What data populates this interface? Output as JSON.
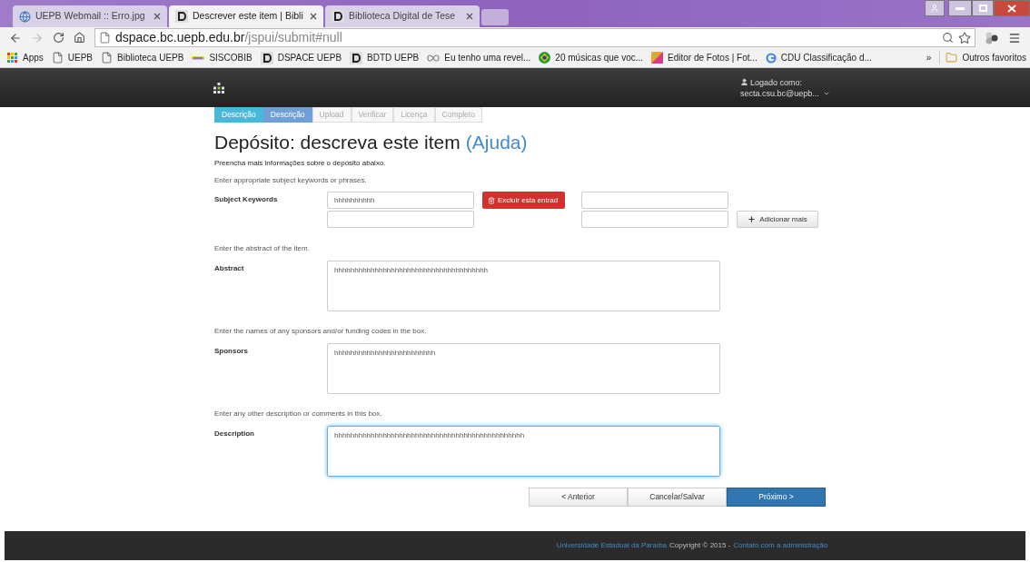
{
  "browser": {
    "tabs": [
      {
        "title": "UEPB Webmail :: Erro.jpg",
        "kind": "mail",
        "selected": false
      },
      {
        "title": "Descrever este item | Bibli",
        "kind": "dspace",
        "selected": true
      },
      {
        "title": "Biblioteca Digital de Tese",
        "kind": "dspace",
        "selected": false
      }
    ],
    "address": {
      "host": "dspace.bc.uepb.edu.br",
      "path": "/jspui/submit#null"
    },
    "bookmarks": [
      {
        "label": "Apps",
        "kind": "apps"
      },
      {
        "label": "UEPB",
        "kind": "page"
      },
      {
        "label": "Biblioteca UEPB",
        "kind": "page"
      },
      {
        "label": "SISCOBIB",
        "kind": "uepb"
      },
      {
        "label": "DSPACE UEPB",
        "kind": "dspace"
      },
      {
        "label": "BDTD UEPB",
        "kind": "dspace"
      },
      {
        "label": "Eu tenho uma revel...",
        "kind": "loop"
      },
      {
        "label": "20 músicas que voc...",
        "kind": "flag"
      },
      {
        "label": "Editor de Fotos | Fot...",
        "kind": "photo"
      },
      {
        "label": "CDU Classificação d...",
        "kind": "google"
      }
    ],
    "overflow": "»",
    "other_bookmarks": "Outros favoritos"
  },
  "header": {
    "logged_label": "Logado como:",
    "user": "secta.csu.bc@uepb..."
  },
  "steps": [
    {
      "label": "Descrição",
      "completed": true,
      "selected": false
    },
    {
      "label": "Descrição",
      "completed": false,
      "selected": true
    },
    {
      "label": "Upload",
      "completed": false,
      "selected": false
    },
    {
      "label": "Verificar",
      "completed": false,
      "selected": false
    },
    {
      "label": "Licença",
      "completed": false,
      "selected": false
    },
    {
      "label": "Completo",
      "completed": false,
      "selected": false
    }
  ],
  "title": "Depósito: descreva este item",
  "help_link": "(Ajuda)",
  "intro": "Preencha mais informações sobre o depósito abaixo.",
  "keywords": {
    "hint": "Enter appropriate subject keywords or phrases.",
    "label": "Subject Keywords",
    "column_1": [
      {
        "value": "hhhhhhhhhh",
        "focused": false
      },
      {
        "focused": false
      }
    ],
    "column_2": [
      {
        "focused": false
      },
      {
        "focused": false
      }
    ],
    "delete_button": "Excluir esta entrad",
    "add_button": "Adicionar mais"
  },
  "text_fields": [
    {
      "hint": "Enter the abstract of the item.",
      "label": "Abstract",
      "value": "hhhhhhhhhhhhhhhhhhhhhhhhhhhhhhhhhhhhhh",
      "focused": false
    },
    {
      "hint": "Enter the names of any sponsors and/or funding codes in the box.",
      "label": "Sponsors",
      "value": "hhhhhhhhhhhhhhhhhhhhhhhhh",
      "focused": false
    },
    {
      "hint": "Enter any other description or comments in this box.",
      "label": "Description",
      "value": "hhhhhhhhhhhhhhhhhhhhhhhhhhhhhhhhhhhhhhhhhhhhhhh",
      "focused": true
    }
  ],
  "buttons": [
    {
      "label": "< Anterior",
      "kind": "default"
    },
    {
      "label": "Cancelar/Salvar",
      "kind": "default"
    },
    {
      "label": "Próximo >",
      "kind": "primary"
    }
  ],
  "footer": {
    "university": "Universidade Estadual da Paraíba",
    "copyright": "Copyright © 2015 -",
    "contact": "Contato com a administração"
  }
}
